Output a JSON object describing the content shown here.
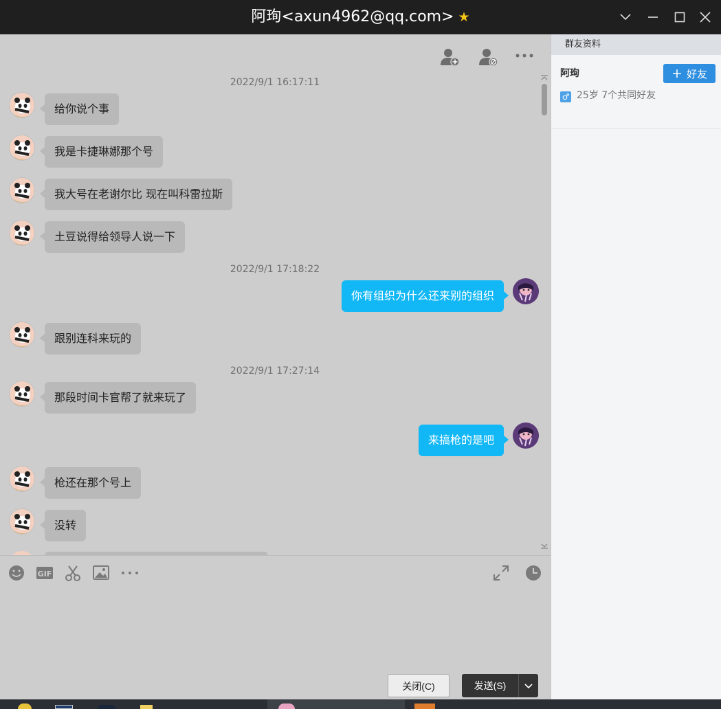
{
  "window": {
    "title": "阿珣<axun4962@qq.com>",
    "star": "★"
  },
  "chat": {
    "timestamps": [
      "2022/9/1 16:17:11",
      "2022/9/1 17:18:22",
      "2022/9/1 17:27:14"
    ],
    "messages": [
      {
        "side": "in",
        "text": "给你说个事"
      },
      {
        "side": "in",
        "text": "我是卡捷琳娜那个号"
      },
      {
        "side": "in",
        "text": "我大号在老谢尔比 现在叫科雷拉斯"
      },
      {
        "side": "in",
        "text": "土豆说得给领导人说一下"
      },
      {
        "side": "out",
        "text": "你有组织为什么还来别的组织"
      },
      {
        "side": "in",
        "text": "跟别连科来玩的"
      },
      {
        "side": "in",
        "text": "那段时间卡官帮了就来玩了"
      },
      {
        "side": "out",
        "text": "来搞枪的是吧"
      },
      {
        "side": "in",
        "text": "枪还在那个号上"
      },
      {
        "side": "in",
        "text": "没转"
      }
    ]
  },
  "input": {
    "close_label": "关闭(C)",
    "send_label": "发送(S)"
  },
  "side": {
    "header": "群友资料",
    "name": "阿珣",
    "add_friend_label": "好友",
    "info": "25岁  7个共同好友",
    "gender_symbol": "♂"
  },
  "colors": {
    "titlebar": "#1f1f1f",
    "chat_bg": "#cdcdcd",
    "bubble_in": "#b9b9b9",
    "bubble_out": "#12b7f5",
    "accent": "#2e8ee0"
  }
}
